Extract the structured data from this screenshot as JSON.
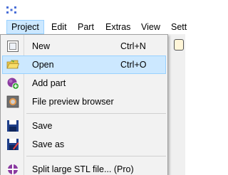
{
  "menubar": {
    "items": [
      {
        "label": "Project",
        "active": true
      },
      {
        "label": "Edit"
      },
      {
        "label": "Part"
      },
      {
        "label": "Extras"
      },
      {
        "label": "View"
      },
      {
        "label": "Sett"
      }
    ]
  },
  "dropdown": {
    "items": [
      {
        "label": "New",
        "shortcut": "Ctrl+N",
        "icon": "new-page-icon"
      },
      {
        "label": "Open",
        "shortcut": "Ctrl+O",
        "icon": "open-folder-icon",
        "highlighted": true
      },
      {
        "label": "Add part",
        "icon": "add-part-icon"
      },
      {
        "label": "File preview browser",
        "icon": "file-preview-icon"
      },
      {
        "label": "Save",
        "icon": "save-disk-icon"
      },
      {
        "label": "Save as",
        "icon": "save-as-disk-icon"
      },
      {
        "label": "Split large STL file... (Pro)",
        "icon": "split-stl-icon"
      }
    ]
  },
  "colors": {
    "highlight_bg": "#cce8ff",
    "highlight_border": "#99d1ff",
    "menu_bg": "#f2f2f2"
  }
}
